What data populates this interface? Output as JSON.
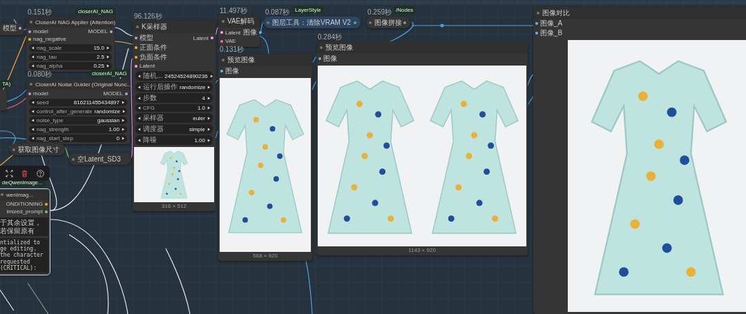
{
  "canvas": {
    "nodes": [
      {
        "kind": "partial",
        "selected": false,
        "outputs": [
          {
            "label": "模型",
            "color": "#b39ddb"
          }
        ]
      },
      {
        "kind": "node",
        "selected": false,
        "time": "0.151秒",
        "badge": "closerAI_NAG",
        "title": "CloserAI NAG Applier (Attention)",
        "inputs": [
          {
            "label": "model",
            "color": "#b39ddb"
          },
          {
            "label": "nag_negative",
            "color": "#ffa931"
          }
        ],
        "outputs": [
          {
            "label": "MODEL",
            "color": "#b39ddb"
          }
        ],
        "widgets": [
          {
            "label": "nag_scale",
            "value": "15.0"
          },
          {
            "label": "nag_tau",
            "value": "2.5"
          },
          {
            "label": "nag_alpha",
            "value": "0.25"
          }
        ]
      },
      {
        "kind": "node",
        "selected": false,
        "time": "0.080秒",
        "badge": "closerAI_NAG",
        "title": "CloserAI Noise Guider (Original Nunc...",
        "inputs": [
          {
            "label": "model",
            "color": "#b39ddb"
          }
        ],
        "outputs": [
          {
            "label": "MODEL",
            "color": "#b39ddb"
          }
        ],
        "widgets": [
          {
            "label": "seed",
            "value": "816211455434897"
          },
          {
            "label": "control_after_generate",
            "value": "randomize"
          },
          {
            "label": "noise_type",
            "value": "gaussian"
          },
          {
            "label": "nag_strength",
            "value": "1.00"
          },
          {
            "label": "nag_start_step",
            "value": "0"
          }
        ]
      },
      {
        "kind": "partial",
        "selected": false,
        "badge": "TA)"
      },
      {
        "kind": "collapsed",
        "selected": false,
        "title": "获取图像尺寸"
      },
      {
        "kind": "collapsed",
        "selected": false,
        "title": "空Latent_SD3"
      },
      {
        "kind": "node",
        "selected": false,
        "time": "96.126秒",
        "title": "K采样器",
        "inputs": [
          {
            "label": "模型",
            "color": "#b39ddb"
          },
          {
            "label": "正面条件",
            "color": "#ffa931"
          },
          {
            "label": "负面条件",
            "color": "#ffa931"
          },
          {
            "label": "Latent",
            "color": "#ff9cf9"
          }
        ],
        "outputs": [
          {
            "label": "Latent",
            "color": "#ff9cf9"
          }
        ],
        "widgets": [
          {
            "label": "随机...",
            "value": "24524524890236"
          },
          {
            "label": "运行后操作",
            "value": "randomize"
          },
          {
            "label": "步数",
            "value": "4"
          },
          {
            "label": "CFG",
            "value": "1.0"
          },
          {
            "label": "采样器",
            "value": "euler"
          },
          {
            "label": "调度器",
            "value": "simple"
          },
          {
            "label": "降噪",
            "value": "1.00"
          }
        ],
        "image": {
          "kind": "photo",
          "caption": "316 × 512"
        }
      },
      {
        "kind": "node",
        "selected": false,
        "time": "11.497秒",
        "title": "VAE解码",
        "inputs": [
          {
            "label": "Latent",
            "color": "#ff9cf9"
          },
          {
            "label": "VAE",
            "color": "#ff6e6e"
          }
        ],
        "outputs": [
          {
            "label": "图像",
            "color": "#64b5f6"
          }
        ]
      },
      {
        "kind": "collapsed",
        "selected": false,
        "color": "#2c4560",
        "time": "0.087秒",
        "badge": "LayerStyle",
        "title": "图层工具：清除VRAM V2"
      },
      {
        "kind": "collapsed",
        "selected": false,
        "time": "0.259秒",
        "badge": "/Nodes",
        "title": "图像拼接"
      },
      {
        "kind": "node",
        "selected": false,
        "time": "0.131秒",
        "title": "预览图像",
        "inputs": [
          {
            "label": "图像",
            "color": "#64b5f6"
          }
        ],
        "image": {
          "kind": "photo",
          "caption": "568 × 920"
        }
      },
      {
        "kind": "node",
        "selected": false,
        "time": "0.284秒",
        "title": "预览图像",
        "inputs": [
          {
            "label": "图像",
            "color": "#64b5f6"
          }
        ],
        "image": {
          "kind": "photo",
          "caption": "1143 × 920"
        }
      },
      {
        "kind": "partial",
        "selected": true,
        "badge": "deQwenImage...",
        "title": "wenImag...",
        "outputs": [
          {
            "label": "ONDITIONING",
            "color": "#ffa931"
          },
          {
            "label": "imized_prompt",
            "color": "#7ccb5f"
          }
        ],
        "textareas": [
          "于其余设置，若保留原有",
          "ntialized to\nge editing.\nthe character\nrequested\n(CRITICAL):"
        ]
      },
      {
        "kind": "node",
        "selected": false,
        "title": "图像对比",
        "inputs": [
          {
            "label": "图像_A",
            "color": "#64b5f6"
          },
          {
            "label": "图像_B",
            "color": "#64b5f6"
          }
        ],
        "image": {
          "kind": "photo"
        }
      }
    ]
  }
}
